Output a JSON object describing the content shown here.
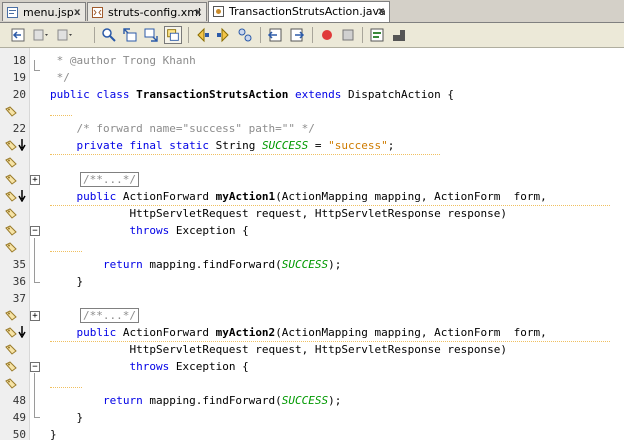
{
  "tabs": [
    {
      "label": "menu.jsp",
      "icon": "jsp-file-icon",
      "active": false
    },
    {
      "label": "struts-config.xml",
      "icon": "xml-file-icon",
      "active": false
    },
    {
      "label": "TransactionStrutsAction.java",
      "icon": "java-file-icon",
      "active": true
    }
  ],
  "close_glyph": "x",
  "toolbar": [
    "back-to-last-edit-icon",
    "navigate-back-icon",
    "navigate-forward-icon",
    "find-selection-icon",
    "find-previous-icon",
    "find-next-icon",
    "toggle-highlight-icon",
    "shift-line-left-icon",
    "shift-line-right-icon",
    "start-macro-recording-icon",
    "stop-macro-recording-icon",
    "comment-icon",
    "uncomment-icon"
  ],
  "lines": {
    "l18": {
      "num": "18",
      "text": " * @author Trong Khanh"
    },
    "l19": {
      "num": "19",
      "text": " */"
    },
    "l20": {
      "num": "20",
      "kw": "public class ",
      "name": "TransactionStrutsAction",
      "kw2": " extends ",
      "rest": "DispatchAction {"
    },
    "l22": {
      "num": "22",
      "text": "    /* forward name=\"success\" path=\"\" */"
    },
    "l23": {
      "kw": "    private final static ",
      "type": "String ",
      "cst": "SUCCESS",
      "eq": " = ",
      "str": "\"success\"",
      "end": ";"
    },
    "l25": {
      "text": "/**...*/"
    },
    "l26": {
      "kw": "    public ",
      "pre": "ActionForward ",
      "name": "myAction1",
      "rest": "(ActionMapping mapping, ActionForm  form,"
    },
    "l27": {
      "text": "            HttpServletRequest request, HttpServletResponse response)"
    },
    "l28": {
      "kw": "            throws ",
      "rest": "Exception {"
    },
    "l35": {
      "num": "35",
      "kw": "        return ",
      "pre": "mapping.findForward(",
      "cst": "SUCCESS",
      "end": ");"
    },
    "l36": {
      "num": "36",
      "text": "    }"
    },
    "l37": {
      "num": "37"
    },
    "l38": {
      "text": "/**...*/"
    },
    "l39": {
      "kw": "    public ",
      "pre": "ActionForward ",
      "name": "myAction2",
      "rest": "(ActionMapping mapping, ActionForm  form,"
    },
    "l40": {
      "text": "            HttpServletRequest request, HttpServletResponse response)"
    },
    "l41": {
      "kw": "            throws ",
      "rest": "Exception {"
    },
    "l48": {
      "num": "48",
      "kw": "        return ",
      "pre": "mapping.findForward(",
      "cst": "SUCCESS",
      "end": ");"
    },
    "l49": {
      "num": "49",
      "text": "    }"
    },
    "l50": {
      "num": "50",
      "text": "}"
    }
  },
  "colors": {
    "keyword": "#0000e6",
    "comment": "#8c8c8c",
    "string": "#ce7b00",
    "constant": "#009900",
    "gutter": "#efefef"
  }
}
